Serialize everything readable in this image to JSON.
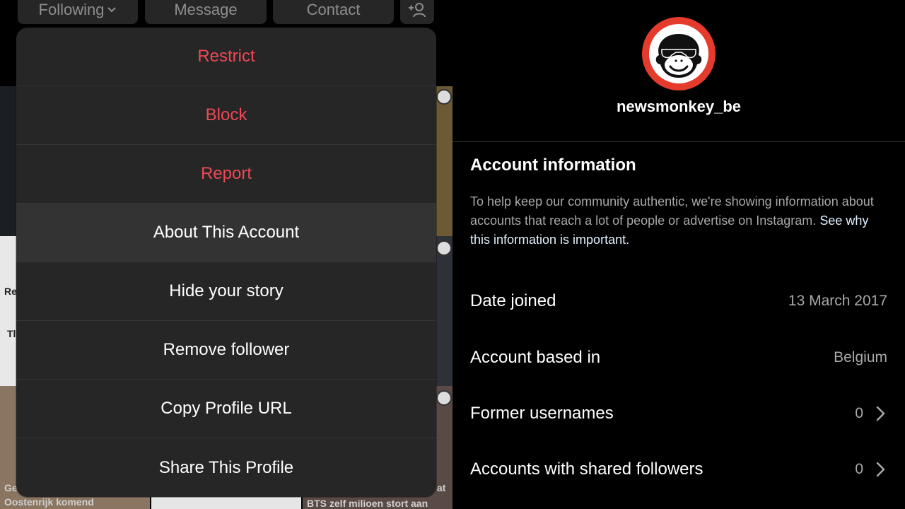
{
  "profile_actions": {
    "following_label": "Following",
    "message_label": "Message",
    "contact_label": "Contact"
  },
  "background_posts": {
    "left_snippets": [
      "Re",
      "Tl",
      "Ge"
    ],
    "caption_1": "Oostenrijk komend",
    "caption_2": "BTS zelf milioen stort aan",
    "caption_2_top": "at"
  },
  "menu": {
    "items": [
      {
        "label": "Restrict"
      },
      {
        "label": "Block"
      },
      {
        "label": "Report"
      },
      {
        "label": "About This Account"
      },
      {
        "label": "Hide your story"
      },
      {
        "label": "Remove follower"
      },
      {
        "label": "Copy Profile URL"
      },
      {
        "label": "Share This Profile"
      }
    ],
    "danger_color": "#ed4956"
  },
  "account": {
    "username": "newsmonkey_be",
    "title": "Account information",
    "description": "To help keep our community authentic, we're showing information about accounts that reach a lot of people or advertise on Instagram.",
    "description_link": "See why this information is important.",
    "rows": [
      {
        "label": "Date joined",
        "value": "13 March 2017"
      },
      {
        "label": "Account based in",
        "value": "Belgium"
      },
      {
        "label": "Former usernames",
        "value": "0"
      },
      {
        "label": "Accounts with shared followers",
        "value": "0"
      }
    ],
    "avatar_ring_color": "#e43b2c"
  }
}
